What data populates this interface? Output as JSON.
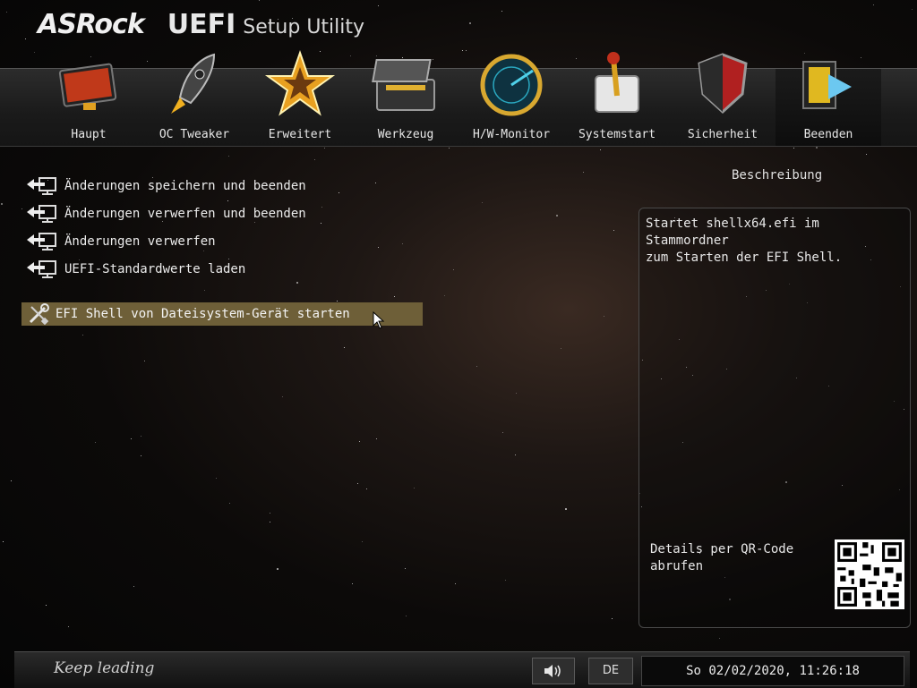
{
  "header": {
    "brand": "ASRock",
    "product": "UEFI",
    "subtitle": "Setup Utility"
  },
  "tabs": [
    {
      "label": "Haupt",
      "icon": "monitor-icon"
    },
    {
      "label": "OC Tweaker",
      "icon": "rocket-icon"
    },
    {
      "label": "Erweitert",
      "icon": "star-icon"
    },
    {
      "label": "Werkzeug",
      "icon": "toolbox-icon"
    },
    {
      "label": "H/W-Monitor",
      "icon": "radar-icon"
    },
    {
      "label": "Systemstart",
      "icon": "power-switch-icon"
    },
    {
      "label": "Sicherheit",
      "icon": "shield-icon"
    },
    {
      "label": "Beenden",
      "icon": "exit-icon",
      "active": true
    }
  ],
  "menu": {
    "items": [
      {
        "label": "Änderungen speichern und beenden",
        "icon": "exit-arrow-icon"
      },
      {
        "label": "Änderungen verwerfen und beenden",
        "icon": "exit-arrow-icon"
      },
      {
        "label": "Änderungen verwerfen",
        "icon": "exit-arrow-icon"
      },
      {
        "label": "UEFI-Standardwerte laden",
        "icon": "exit-arrow-icon"
      }
    ],
    "selected": {
      "label": "EFI Shell von Dateisystem-Gerät starten",
      "icon": "tools-icon"
    }
  },
  "description": {
    "title": "Beschreibung",
    "text": "Startet shellx64.efi im Stammordner\nzum Starten der EFI Shell.",
    "qr_text": "Details per QR-Code\nabrufen"
  },
  "footer": {
    "tagline": "Keep leading",
    "sound_icon": "speaker-icon",
    "language": "DE",
    "datetime": "So 02/02/2020, 11:26:18"
  },
  "colors": {
    "selection": "#6e5f38",
    "tab_active": "#0d0d0d",
    "accent_gold": "#e0b030"
  }
}
